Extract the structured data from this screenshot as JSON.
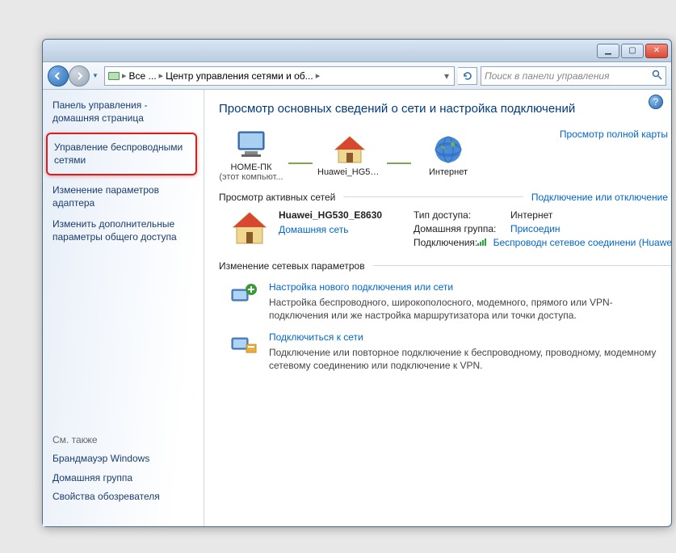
{
  "titlebar": {
    "min": "▁",
    "max": "▢",
    "close": "✕"
  },
  "nav": {
    "crumb1": "Все ...",
    "crumb2": "Центр управления сетями и об...",
    "search_placeholder": "Поиск в панели управления"
  },
  "sidebar": {
    "home": "Панель управления - домашняя страница",
    "links": [
      "Управление беспроводными сетями",
      "Изменение параметров адаптера",
      "Изменить дополнительные параметры общего доступа"
    ],
    "see_also_title": "См. также",
    "see_also": [
      "Брандмауэр Windows",
      "Домашняя группа",
      "Свойства обозревателя"
    ]
  },
  "main": {
    "title": "Просмотр основных сведений о сети и настройка подключений",
    "map_link": "Просмотр полной карты",
    "node_pc": "HOME-ПК",
    "node_pc_sub": "(этот компьют...",
    "node_router": "Huawei_HG530...",
    "node_internet": "Интернет",
    "active_hdr": "Просмотр активных сетей",
    "active_action": "Подключение или отключение",
    "net_name": "Huawei_HG530_E8630",
    "net_type": "Домашняя сеть",
    "prop_access_label": "Тип доступа:",
    "prop_access_val": "Интернет",
    "prop_homegroup_label": "Домашняя группа:",
    "prop_homegroup_val": "Присоедин",
    "prop_conn_label": "Подключения:",
    "prop_conn_val": "Беспроводн сетевое соединени (Huawei_HG",
    "settings_hdr": "Изменение сетевых параметров",
    "ns1_title": "Настройка нового подключения или сети",
    "ns1_desc": "Настройка беспроводного, широкополосного, модемного, прямого или VPN-подключения или же настройка маршрутизатора или точки доступа.",
    "ns2_title": "Подключиться к сети",
    "ns2_desc": "Подключение или повторное подключение к беспроводному, проводному, модемному сетевому соединению или подключение к VPN."
  }
}
